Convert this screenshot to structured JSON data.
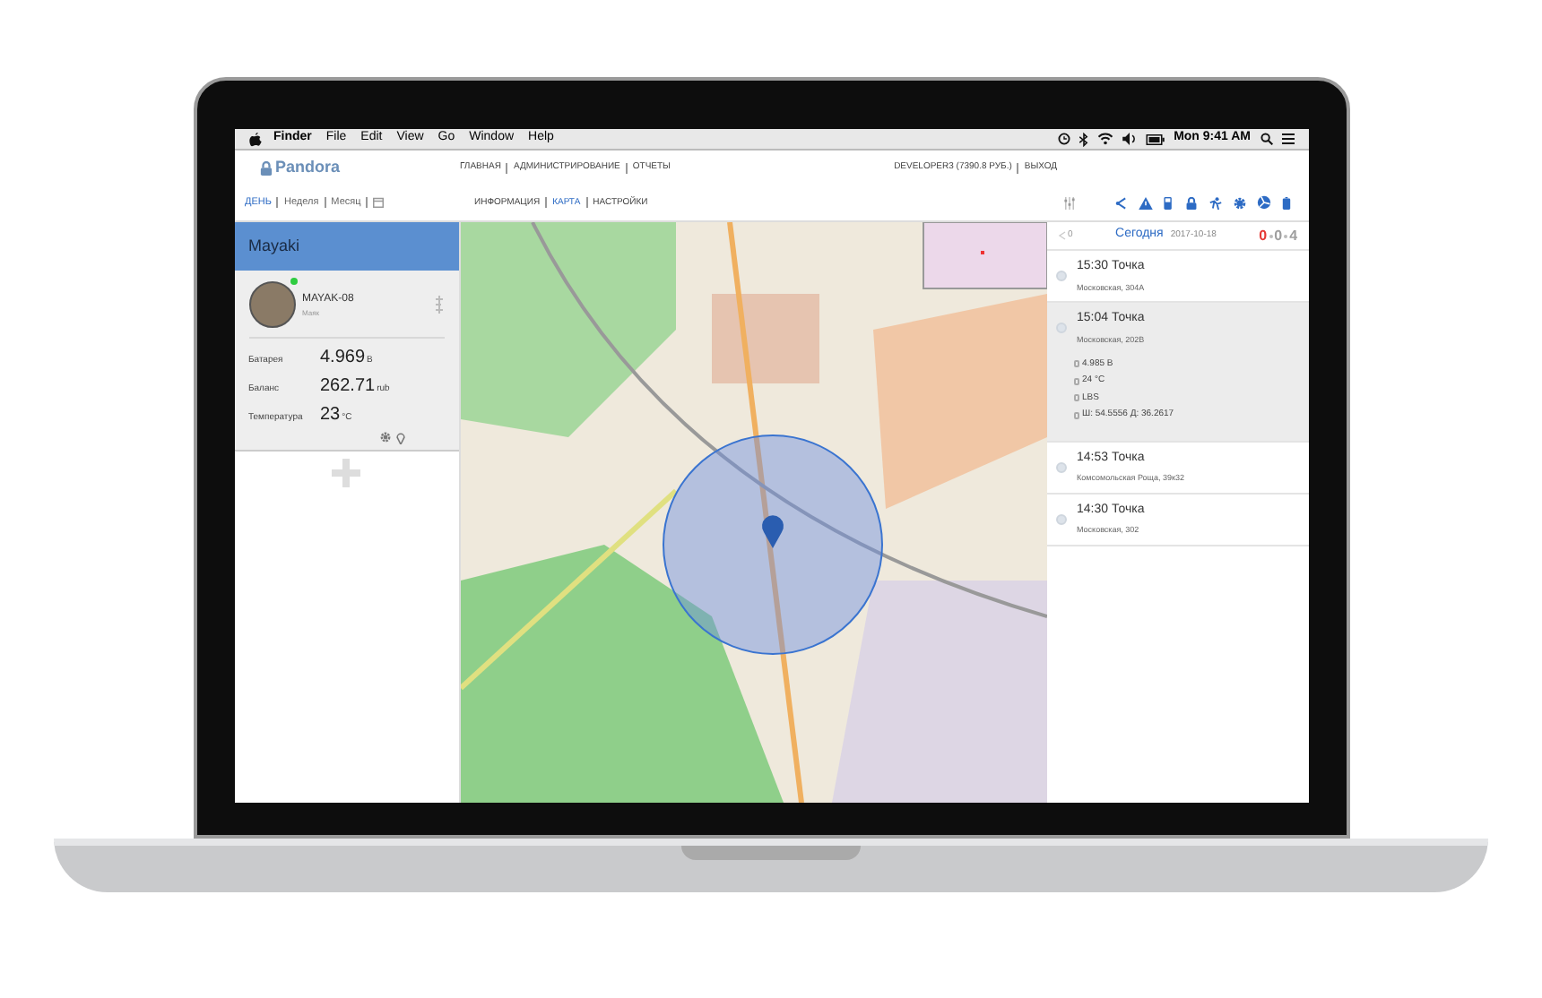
{
  "menubar": {
    "items": [
      "Finder",
      "File",
      "Edit",
      "View",
      "Go",
      "Window",
      "Help"
    ],
    "clock": "Mon 9:41 AM"
  },
  "header": {
    "logo": "Pandora",
    "nav": [
      "ГЛАВНАЯ",
      "АДМИНИСТРИРОВАНИЕ",
      "ОТЧЕТЫ"
    ],
    "account": "DEVELOPER3 (7390.8 РУБ.)",
    "logout": "ВЫХОД"
  },
  "period_tabs": [
    {
      "label": "ДЕНЬ",
      "selected": true
    },
    {
      "label": "Неделя",
      "selected": false
    },
    {
      "label": "Месяц",
      "selected": false
    }
  ],
  "view_tabs": [
    {
      "label": "ИНФОРМАЦИЯ",
      "selected": false
    },
    {
      "label": "КАРТА",
      "selected": true
    },
    {
      "label": "НАСТРОЙКИ",
      "selected": false
    }
  ],
  "sidebar": {
    "group": "Mayaki",
    "device": {
      "name": "MAYAK-08",
      "subtitle": "Маяк",
      "online": true
    },
    "metrics": [
      {
        "label": "Батарея",
        "value": "4.969",
        "unit": "В"
      },
      {
        "label": "Баланс",
        "value": "262.71",
        "unit": "rub"
      },
      {
        "label": "Температура",
        "value": "23",
        "unit": "°C"
      }
    ]
  },
  "events_panel": {
    "share_count": "0",
    "title": "Сегодня",
    "date": "2017-10-18",
    "counters": [
      {
        "text": "0",
        "color": "#e53935"
      },
      {
        "text": "0",
        "color": "#9e9e9e"
      },
      {
        "text": "4",
        "color": "#9e9e9e"
      }
    ],
    "events": [
      {
        "time": "15:30",
        "type": "Точка",
        "address": "Московская, 304А",
        "selected": false
      },
      {
        "time": "15:04",
        "type": "Точка",
        "address": "Московская, 202В",
        "selected": true,
        "details": [
          "4.985 В",
          "24 °C",
          "LBS",
          "Ш: 54.5556 Д: 36.2617"
        ]
      },
      {
        "time": "14:53",
        "type": "Точка",
        "address": "Комсомольская Роща, 39к32",
        "selected": false
      },
      {
        "time": "14:30",
        "type": "Точка",
        "address": "Московская, 302",
        "selected": false
      }
    ]
  }
}
